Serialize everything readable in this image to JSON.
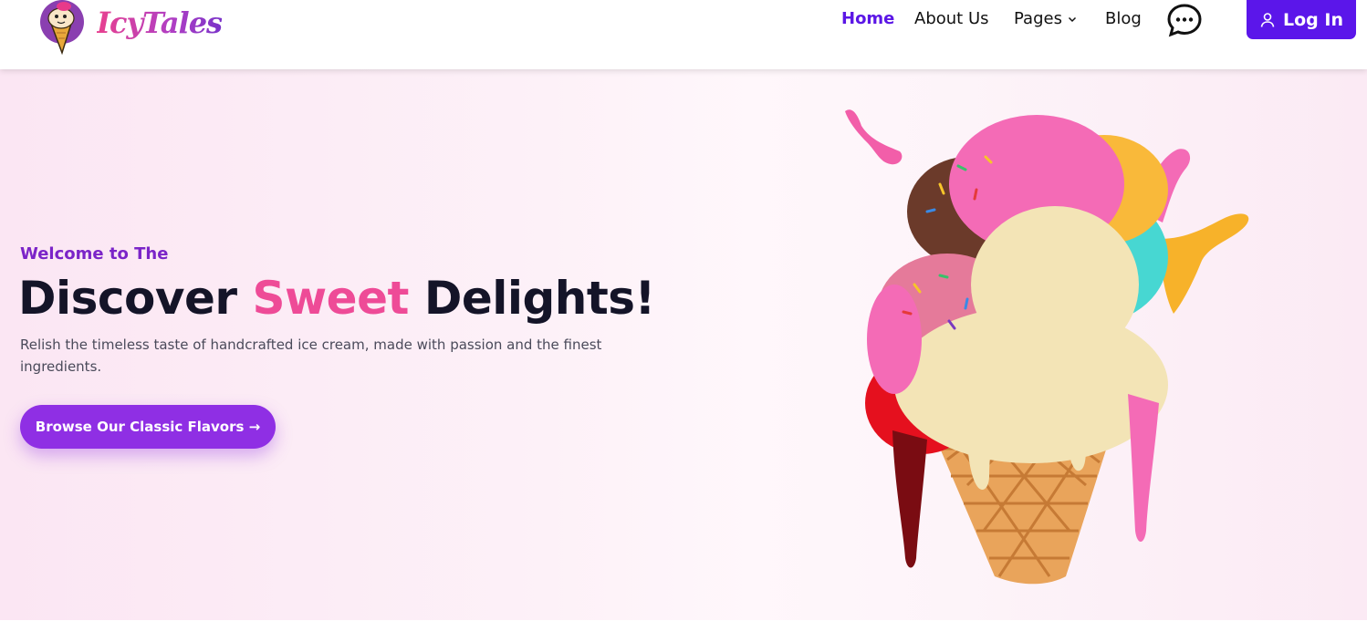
{
  "brand": {
    "name": "IcyTales"
  },
  "nav": {
    "home": "Home",
    "about": "About Us",
    "pages": "Pages",
    "blog": "Blog",
    "chat_icon": "chat-bubble-icon",
    "login": "Log In",
    "login_icon": "user-icon"
  },
  "hero": {
    "eyebrow": "Welcome to The",
    "headline_start": "Discover ",
    "headline_accent": "Sweet",
    "headline_end": " Delights!",
    "description": "Relish the timeless taste of handcrafted ice cream, made with passion and the finest ingredients.",
    "cta": "Browse Our Classic Flavors →",
    "image": "ice-cream-cone-illustration"
  },
  "colors": {
    "primary": "#5b16ea",
    "accent_pink": "#ee4b97",
    "cta_purple": "#8f2fe4",
    "eyebrow_purple": "#7b24c8",
    "hero_bg": "#fbe6f3"
  }
}
